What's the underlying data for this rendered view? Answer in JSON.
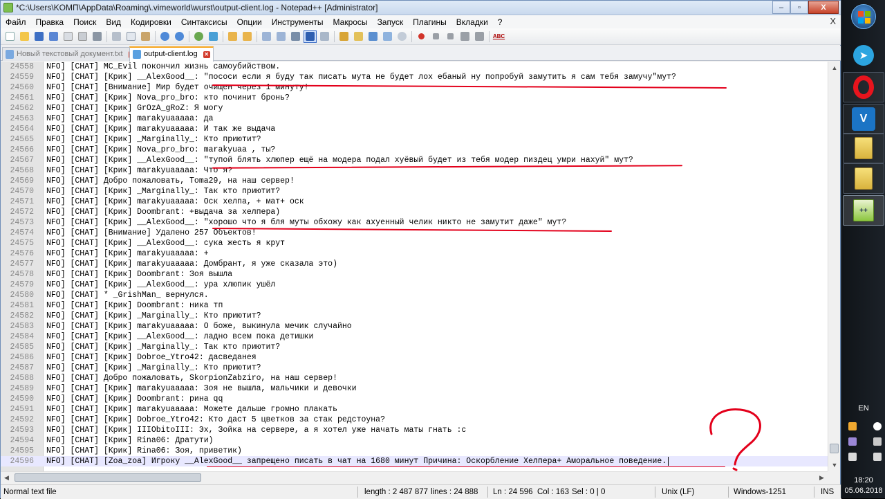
{
  "window": {
    "title": "*C:\\Users\\KOMП\\AppData\\Roaming\\.vimeworld\\wurst\\output-client.log - Notepad++ [Administrator]",
    "controls": [
      "–",
      "▫",
      "X"
    ]
  },
  "menu": {
    "items": [
      "Файл",
      "Правка",
      "Поиск",
      "Вид",
      "Кодировки",
      "Синтаксисы",
      "Опции",
      "Инструменты",
      "Макросы",
      "Запуск",
      "Плагины",
      "Вкладки",
      "?"
    ],
    "close": "X"
  },
  "toolbar": {
    "spellcheck_label": "ABC",
    "icons": [
      "new-file-icon",
      "open-file-icon",
      "save-icon",
      "save-all-icon",
      "close-icon",
      "close-all-icon",
      "print-icon",
      "cut-icon",
      "copy-icon",
      "paste-icon",
      "undo-icon",
      "redo-icon",
      "find-icon",
      "replace-icon",
      "zoom-in-icon",
      "zoom-out-icon",
      "sync-v-icon",
      "sync-h-icon",
      "word-wrap-icon",
      "show-all-chars-icon",
      "indent-guide-icon",
      "lang-icon",
      "folder-workspace-icon",
      "function-list-icon",
      "doc-map-icon",
      "monitor-icon",
      "record-macro-icon",
      "stop-macro-icon",
      "play-macro-icon",
      "run-macro-icon",
      "save-macro-icon",
      "spellcheck-icon"
    ]
  },
  "tabs": [
    {
      "label": "Новый текстовый документ.txt",
      "active": false
    },
    {
      "label": "output-client.log",
      "active": true
    }
  ],
  "editor": {
    "lines": [
      {
        "n": "24558",
        "text": "NFO] [CHAT] MC_Evil покончил жизнь самоубийством."
      },
      {
        "n": "24559",
        "text": "NFO] [CHAT] [Крик] __AlexGood__: \"пососи если я буду так писать мута не будет лох ебаный ну попробуй замутить я сам тебя замучу\"мут?"
      },
      {
        "n": "24560",
        "text": "NFO] [CHAT] [Внимание] Мир будет очищен через 1 минуту!"
      },
      {
        "n": "24561",
        "text": "NFO] [CHAT] [Крик] Nova_pro_bro: кто починит бронь?"
      },
      {
        "n": "24562",
        "text": "NFO] [CHAT] [Крик] GrOzA_gRoZ: Я могу"
      },
      {
        "n": "24563",
        "text": "NFO] [CHAT] [Крик] marakyuaaaaa: да"
      },
      {
        "n": "24564",
        "text": "NFO] [CHAT] [Крик] marakyuaaaaa: И так же выдача"
      },
      {
        "n": "24565",
        "text": "NFO] [CHAT] [Крик] _Marginally_: Кто приютит?"
      },
      {
        "n": "24566",
        "text": "NFO] [CHAT] [Крик] Nova_pro_bro:  marakyuaa , ты?"
      },
      {
        "n": "24567",
        "text": "NFO] [CHAT] [Крик] __AlexGood__: \"тупой блять хлюпер ещё на модера подал хуёвый будет из тебя модер пиздец умри нахуй\" мут?"
      },
      {
        "n": "24568",
        "text": "NFO] [CHAT] [Крик] marakyuaaaaa: Что я?"
      },
      {
        "n": "24569",
        "text": "NFO] [CHAT] Добро пожаловать, Toma29, на наш сервер!"
      },
      {
        "n": "24570",
        "text": "NFO] [CHAT] [Крик] _Marginally_: Так кто приютит?"
      },
      {
        "n": "24571",
        "text": "NFO] [CHAT] [Крик] marakyuaaaaa: Оск хелпа, + мат+ оск"
      },
      {
        "n": "24572",
        "text": "NFO] [CHAT] [Крик] Doombrant:  +выдача за хелпера)"
      },
      {
        "n": "24573",
        "text": "NFO] [CHAT] [Крик] __AlexGood__: \"хорошо что я бля муты обхожу как ахуенный челик никто не замутит даже\" мут?"
      },
      {
        "n": "24574",
        "text": "NFO] [CHAT] [Внимание] Удалено 257 Объектов!"
      },
      {
        "n": "24575",
        "text": "NFO] [CHAT] [Крик] __AlexGood__: сука жесть я крут"
      },
      {
        "n": "24576",
        "text": "NFO] [CHAT] [Крик] marakyuaaaaa: +"
      },
      {
        "n": "24577",
        "text": "NFO] [CHAT] [Крик] marakyuaaaaa: Домбрант, я уже сказала это)"
      },
      {
        "n": "24578",
        "text": "NFO] [CHAT] [Крик] Doombrant:  Зоя вышла"
      },
      {
        "n": "24579",
        "text": "NFO] [CHAT] [Крик] __AlexGood__: ура хлюпик ушёл"
      },
      {
        "n": "24580",
        "text": "NFO] [CHAT] * _GrishMan_  вернулся."
      },
      {
        "n": "24581",
        "text": "NFO] [CHAT] [Крик] Doombrant:  ника тп"
      },
      {
        "n": "24582",
        "text": "NFO] [CHAT] [Крик] _Marginally_: Кто приютит?"
      },
      {
        "n": "24583",
        "text": "NFO] [CHAT] [Крик] marakyuaaaaa: О боже, выкинула мечик случайно"
      },
      {
        "n": "24584",
        "text": "NFO] [CHAT] [Крик] __AlexGood__: ладно всем пока детишки"
      },
      {
        "n": "24585",
        "text": "NFO] [CHAT] [Крик] _Marginally_: Так кто приютит?"
      },
      {
        "n": "24586",
        "text": "NFO] [CHAT] [Крик] Dobroe_Ytro42: дасведанея"
      },
      {
        "n": "24587",
        "text": "NFO] [CHAT] [Крик] _Marginally_: Кто приютит?"
      },
      {
        "n": "24588",
        "text": "NFO] [CHAT] Добро пожаловать, SkorpionZabziro, на наш сервер!"
      },
      {
        "n": "24589",
        "text": "NFO] [CHAT] [Крик] marakyuaaaaa: Зоя не вышла, мальчики и девочки"
      },
      {
        "n": "24590",
        "text": "NFO] [CHAT] [Крик] Doombrant:  рина qq"
      },
      {
        "n": "24591",
        "text": "NFO] [CHAT] [Крик] marakyuaaaaa: Можете дальше громно плакать"
      },
      {
        "n": "24592",
        "text": "NFO] [CHAT] [Крик] Dobroe_Ytro42: Кто даст 5 цветков за стак редстоуна?"
      },
      {
        "n": "24593",
        "text": "NFO] [CHAT] [Крик] IIIObitoIII: Эх, Зойка на сервере, а я хотел уже начать маты гнать :с"
      },
      {
        "n": "24594",
        "text": "NFO] [CHAT] [Крик] Rina06: Дратути)"
      },
      {
        "n": "24595",
        "text": "NFO] [CHAT] [Крик] Rina06: Зоя, приветик)"
      },
      {
        "n": "24596",
        "text": "NFO] [CHAT] [Zoa_zoa] Игроку __AlexGood__ запрещено писать в чат на 1680 минут Причина:  Оскорбление Хелпера+ Аморальное поведение."
      }
    ],
    "current_line": "24596",
    "underline_color": "#e3001b",
    "annotation": "?"
  },
  "statusbar": {
    "type": "Normal text file",
    "length": "length : 2 487 877",
    "lines": "lines : 24 888",
    "ln": "Ln : 24 596",
    "col": "Col : 163",
    "sel": "Sel : 0 | 0",
    "eol": "Unix (LF)",
    "encoding": "Windows-1251",
    "mode": "INS"
  },
  "taskbar": {
    "lang": "EN",
    "time": "18:20",
    "date": "05.06.2018",
    "apps": [
      "start-orb",
      "telegram-icon",
      "opera-icon",
      "vimeworld-icon",
      "folder-icon",
      "folder-icon",
      "notepadpp-icon"
    ]
  }
}
